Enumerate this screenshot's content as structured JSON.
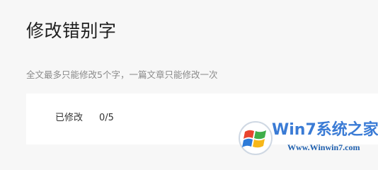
{
  "page": {
    "title": "修改错别字",
    "note": "全文最多只能修改5个字，一篇文章只能修改一次"
  },
  "panel": {
    "count_label": "已修改",
    "count_value": "0/5"
  },
  "watermark": {
    "brand": "Win7系统之家",
    "url": "Www.Winwin7.com",
    "logo_icon": "windows-flag-icon",
    "colors": {
      "brand_blue": "#3a7bd5",
      "red": "#e8442e",
      "green": "#3fae49",
      "blue": "#2d7bd8",
      "yellow": "#f7b719"
    }
  }
}
